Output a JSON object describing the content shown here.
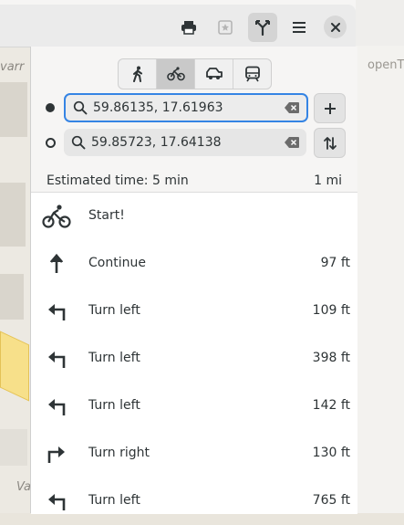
{
  "map": {
    "labels": [
      "varr",
      "openT",
      "Va"
    ]
  },
  "header": {
    "print_icon": "printer-icon",
    "favorite_icon": "star-icon",
    "route_icon": "route-icon",
    "menu_icon": "hamburger-icon",
    "close_icon": "close-icon"
  },
  "modes": [
    {
      "name": "walk",
      "icon": "pedestrian-icon",
      "active": false
    },
    {
      "name": "bike",
      "icon": "bicycle-icon",
      "active": true
    },
    {
      "name": "car",
      "icon": "car-icon",
      "active": false
    },
    {
      "name": "transit",
      "icon": "train-icon",
      "active": false
    }
  ],
  "route": {
    "from": "59.86135, 17.61963",
    "to": "59.85723, 17.64138",
    "estimated_time": "Estimated time: 5 min",
    "distance": "1 mi"
  },
  "instructions": [
    {
      "icon": "bicycle-icon",
      "text": "Start!",
      "distance": ""
    },
    {
      "icon": "arrow-up-icon",
      "text": "Continue",
      "distance": "97 ft"
    },
    {
      "icon": "turn-left-icon",
      "text": "Turn left",
      "distance": "109 ft"
    },
    {
      "icon": "turn-left-icon",
      "text": "Turn left",
      "distance": "398 ft"
    },
    {
      "icon": "turn-left-icon",
      "text": "Turn left",
      "distance": "142 ft"
    },
    {
      "icon": "turn-right-icon",
      "text": "Turn right",
      "distance": "130 ft"
    },
    {
      "icon": "turn-left-icon",
      "text": "Turn left",
      "distance": "765 ft"
    }
  ],
  "colors": {
    "accent": "#3584e4",
    "road": "#f7e08a"
  }
}
